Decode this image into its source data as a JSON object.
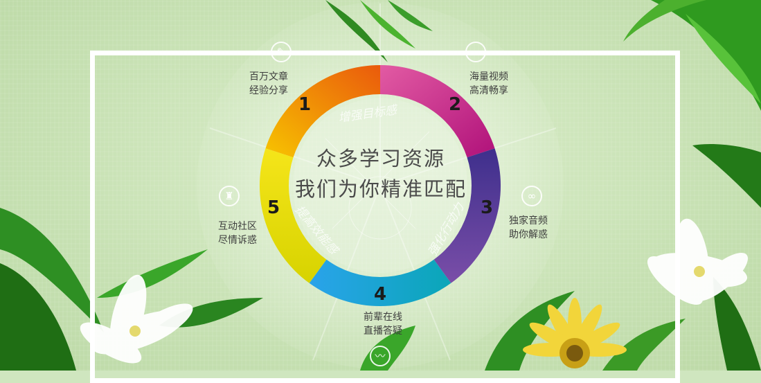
{
  "center": {
    "line1": "众多学习资源",
    "line2": "我们为你精准匹配"
  },
  "segments": [
    {
      "number": "1",
      "line1": "百万文章",
      "line2": "经验分享",
      "icon": "pencil-icon",
      "color": "#f08a10"
    },
    {
      "number": "2",
      "line1": "海量视频",
      "line2": "高清畅享",
      "icon": "video-icon",
      "color": "#d21f86"
    },
    {
      "number": "3",
      "line1": "独家音频",
      "line2": "助你解惑",
      "icon": "link-icon",
      "color": "#5a2f8e"
    },
    {
      "number": "4",
      "line1": "前辈在线",
      "line2": "直播答疑",
      "icon": "chart-icon",
      "color": "#1e9fd8"
    },
    {
      "number": "5",
      "line1": "互动社区",
      "line2": "尽情诉惑",
      "icon": "community-icon",
      "color": "#e8d400"
    }
  ],
  "inner_watermarks": [
    "增强目标感",
    "强化行动力",
    "提高效能感"
  ]
}
